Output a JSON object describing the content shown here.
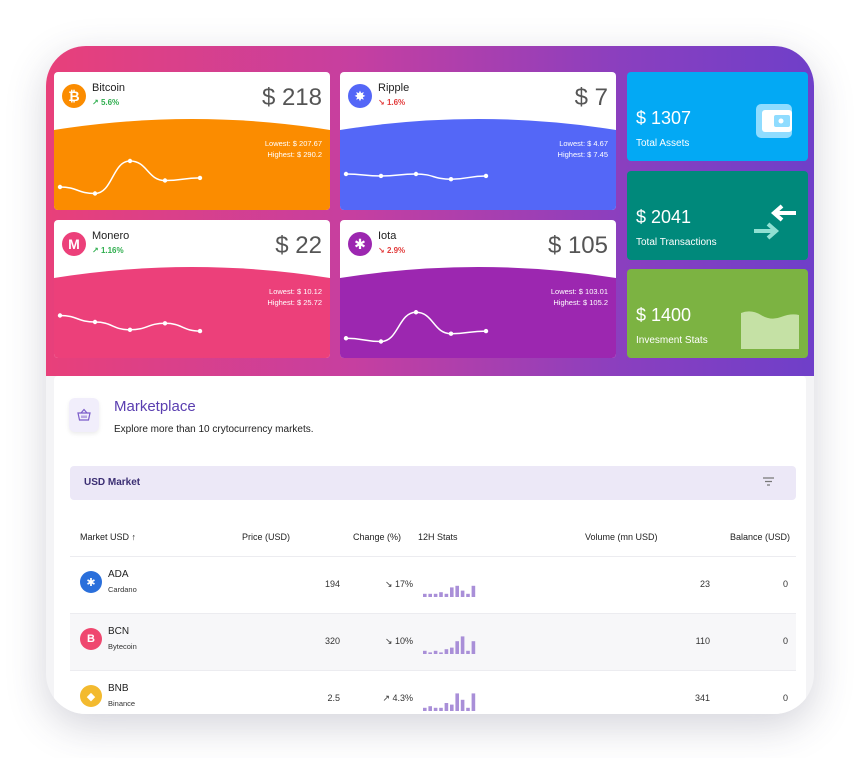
{
  "colors": {
    "bitcoin": "#fb8c00",
    "ripple": "#5467f7",
    "monero": "#ec407a",
    "iota": "#9c27b0",
    "assets": "#03a9f4",
    "transactions": "#00897b",
    "investment": "#7cb342",
    "accent": "#5a3eb0"
  },
  "coins": [
    {
      "name": "Bitcoin",
      "change": "5.6%",
      "trend": "up",
      "price": "$ 218",
      "lowest": "Lowest: $ 207.67",
      "highest": "Highest: $ 290.2",
      "icon": "bitcoin-icon",
      "spark": [
        2,
        1,
        6,
        3,
        3.4
      ]
    },
    {
      "name": "Ripple",
      "change": "1.6%",
      "trend": "down",
      "price": "$ 7",
      "lowest": "Lowest: $ 4.67",
      "highest": "Highest: $ 7.45",
      "icon": "ripple-icon",
      "spark": [
        4,
        3.7,
        4,
        3.2,
        3.7
      ]
    },
    {
      "name": "Monero",
      "change": "1.16%",
      "trend": "up",
      "price": "$ 22",
      "lowest": "Lowest: $ 10.12",
      "highest": "Highest: $ 25.72",
      "icon": "monero-icon",
      "spark": [
        5,
        4,
        2.8,
        3.8,
        2.6
      ]
    },
    {
      "name": "Iota",
      "change": "2.9%",
      "trend": "down",
      "price": "$ 105",
      "lowest": "Lowest: $ 103.01",
      "highest": "Highest: $ 105.2",
      "icon": "iota-icon",
      "spark": [
        1.5,
        1,
        5.5,
        2.2,
        2.6
      ]
    }
  ],
  "stats": [
    {
      "value": "$ 1307",
      "label": "Total Assets",
      "icon": "wallet-icon"
    },
    {
      "value": "$ 2041",
      "label": "Total Transactions",
      "icon": "transfer-arrows-icon"
    },
    {
      "value": "$ 1400",
      "label": "Invesment Stats",
      "icon": "area-chart-icon"
    }
  ],
  "marketplace": {
    "title": "Marketplace",
    "subtitle": "Explore more than 10 crytocurrency markets.",
    "icon": "basket-icon",
    "market_label": "USD Market"
  },
  "table": {
    "headers": [
      "Market USD ↑",
      "Price (USD)",
      "Change (%)",
      "12H Stats",
      "Volume (mn USD)",
      "Balance (USD)"
    ],
    "rows": [
      {
        "symbol": "ADA",
        "name": "Cardano",
        "price": "194",
        "change": "17%",
        "trend": "down",
        "volume": "23",
        "balance": "0",
        "icon": "cardano-icon",
        "color": "#2a6fdb",
        "stats": [
          2,
          2,
          2,
          3,
          2,
          6,
          7,
          4,
          2,
          7
        ]
      },
      {
        "symbol": "BCN",
        "name": "Bytecoin",
        "price": "320",
        "change": "10%",
        "trend": "down",
        "volume": "110",
        "balance": "0",
        "icon": "bytecoin-icon",
        "color": "#ef476f",
        "stats": [
          2,
          1,
          2,
          1,
          3,
          4,
          8,
          11,
          2,
          8
        ]
      },
      {
        "symbol": "BNB",
        "name": "Binance",
        "price": "2.5",
        "change": "4.3%",
        "trend": "up",
        "volume": "341",
        "balance": "0",
        "icon": "binance-icon",
        "color": "#f3ba2f",
        "stats": [
          2,
          3,
          2,
          2,
          5,
          4,
          11,
          7,
          2,
          11
        ]
      }
    ]
  }
}
